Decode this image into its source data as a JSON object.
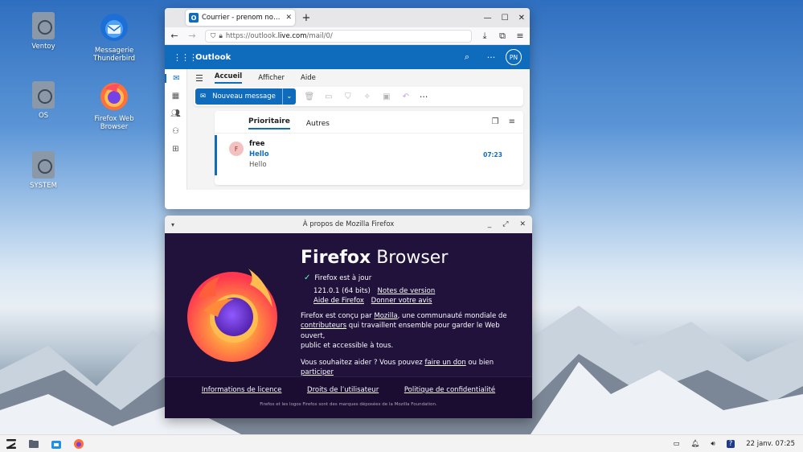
{
  "desktop": {
    "icons": [
      {
        "label": "Ventoy"
      },
      {
        "label": "Messagerie Thunderbird"
      },
      {
        "label": "OS"
      },
      {
        "label": "Firefox Web Browser"
      },
      {
        "label": "SYSTEM"
      }
    ]
  },
  "firefox_window": {
    "tab_title": "Courrier - prenom nom - O",
    "tab_icon": "outlook-icon",
    "tab_icon_letter": "O",
    "url_prefix": "https://outlook.",
    "url_domain": "live.com",
    "url_path": "/mail/0/"
  },
  "outlook": {
    "brand": "Outlook",
    "avatar_initials": "PN",
    "ribbon_tabs": [
      "Accueil",
      "Afficher",
      "Aide"
    ],
    "new_message_label": "Nouveau message",
    "more_label": "···",
    "list_tabs": [
      "Prioritaire",
      "Autres"
    ],
    "messages": [
      {
        "avatar": "F",
        "from": "free",
        "subject": "Hello",
        "preview": "Hello",
        "time": "07:23"
      }
    ],
    "accent_color": "#0f6cbd"
  },
  "about_dialog": {
    "title": "À propos de Mozilla Firefox",
    "product_bold": "Firefox",
    "product_light": "Browser",
    "update_status": "Firefox est à jour",
    "version": "121.0.1 (64 bits)",
    "release_notes": "Notes de version",
    "help_link": "Aide de Firefox",
    "feedback_link": "Donner votre avis",
    "desc_1": "Firefox est conçu par ",
    "desc_mozilla": "Mozilla",
    "desc_2": ", une communauté mondiale de",
    "desc_contributors": "contributeurs",
    "desc_3": " qui travaillent ensemble pour garder le Web ouvert,",
    "desc_4": "public et accessible à tous.",
    "help_1": "Vous souhaitez aider ? Vous pouvez ",
    "help_donate": "faire un don",
    "help_2": " ou bien ",
    "help_participate": "participer",
    "footer_links": [
      "Informations de licence",
      "Droits de l’utilisateur",
      "Politique de confidentialité"
    ],
    "trademark": "Firefox et les logos Firefox sont des marques déposées de la Mozilla Foundation."
  },
  "taskbar": {
    "date": "22 janv.",
    "time": "07:25"
  }
}
